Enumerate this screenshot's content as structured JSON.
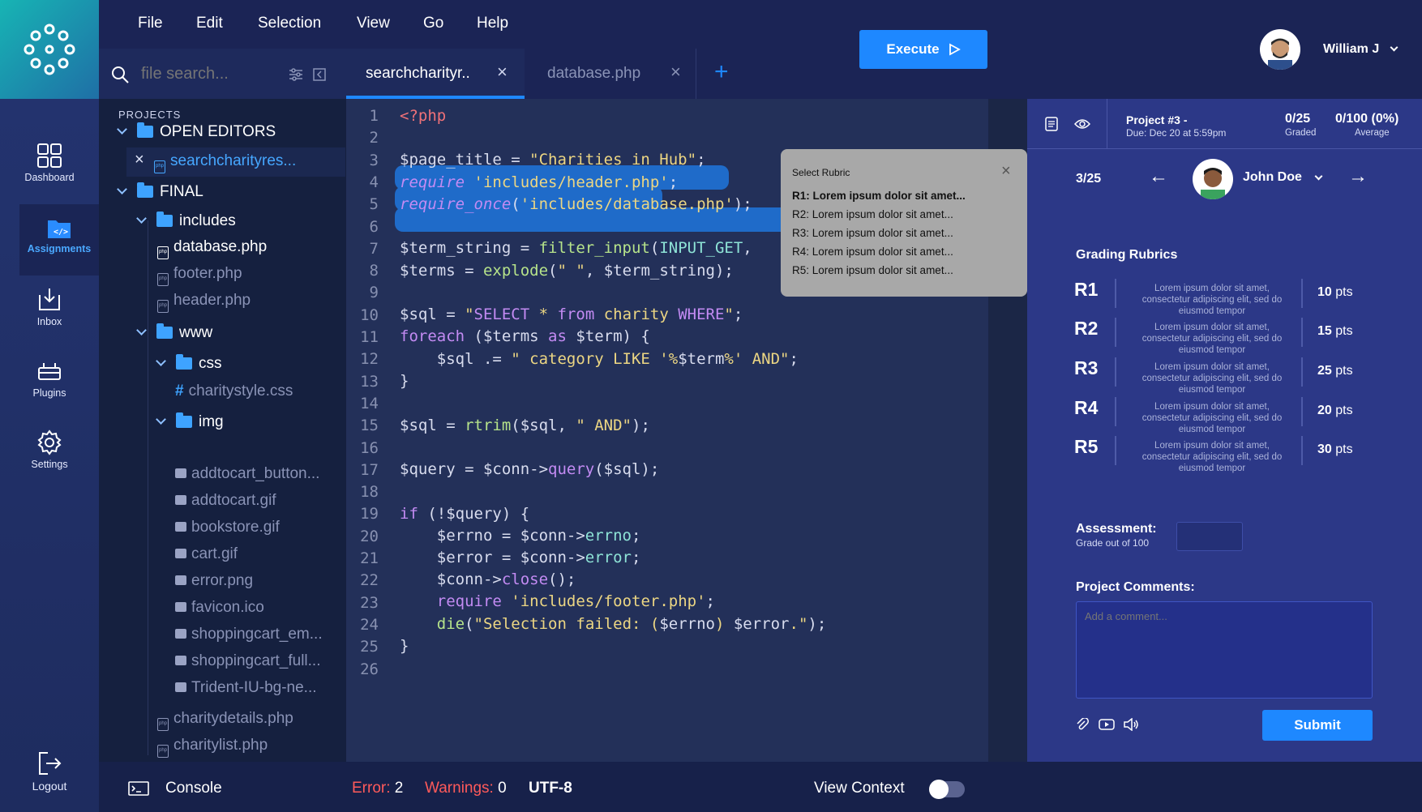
{
  "menu": [
    "File",
    "Edit",
    "Selection",
    "View",
    "Go",
    "Help"
  ],
  "execute_label": "Execute",
  "user_name": "William J",
  "search_placeholder": "file search...",
  "tabs": [
    {
      "label": "searchcharityr.."
    },
    {
      "label": "database.php"
    }
  ],
  "sidebar": [
    {
      "label": "Dashboard"
    },
    {
      "label": "Assignments"
    },
    {
      "label": "Inbox"
    },
    {
      "label": "Plugins"
    },
    {
      "label": "Settings"
    },
    {
      "label": "Logout"
    }
  ],
  "tree": {
    "section": "PROJECTS",
    "open_editors": "OPEN EDITORS",
    "open_file": "searchcharityres...",
    "final": "FINAL",
    "includes": "includes",
    "inc_files": [
      "database.php",
      "footer.php",
      "header.php"
    ],
    "www": "www",
    "css": "css",
    "css_file": "charitystyle.css",
    "img": "img",
    "img_files": [
      "addtocart_button...",
      "addtocart.gif",
      "bookstore.gif",
      "cart.gif",
      "error.png",
      "favicon.ico",
      "shoppingcart_em...",
      "shoppingcart_full...",
      "Trident-IU-bg-ne..."
    ],
    "php_files": [
      "charitydetails.php",
      "charitylist.php"
    ]
  },
  "code_lines": [
    "1",
    "2",
    "3",
    "4",
    "5",
    "6",
    "7",
    "8",
    "9",
    "10",
    "11",
    "12",
    "13",
    "14",
    "15",
    "16",
    "17",
    "18",
    "19",
    "20",
    "21",
    "22",
    "23",
    "24",
    "25",
    "26"
  ],
  "rubric_popup": {
    "title": "Select Rubric",
    "items": [
      "R1: Lorem ipsum dolor sit amet...",
      "R2: Lorem ipsum dolor sit amet...",
      "R3: Lorem ipsum dolor sit amet...",
      "R4: Lorem ipsum dolor sit amet...",
      "R5: Lorem ipsum dolor sit amet..."
    ]
  },
  "project": {
    "title": "Project #3 -",
    "due": "Due: Dec 20 at 5:59pm",
    "graded_value": "0/25",
    "graded_label": "Graded",
    "average_value": "0/100 (0%)",
    "average_label": "Average"
  },
  "student": {
    "position": "3/25",
    "name": "John Doe"
  },
  "rubrics_title": "Grading Rubrics",
  "rubrics": [
    {
      "code": "R1",
      "desc": "Lorem ipsum dolor sit amet, consectetur adipiscing elit, sed do eiusmod tempor",
      "pts": "10",
      "unit": "pts"
    },
    {
      "code": "R2",
      "desc": "Lorem ipsum dolor sit amet, consectetur adipiscing elit, sed do eiusmod tempor",
      "pts": "15",
      "unit": "pts"
    },
    {
      "code": "R3",
      "desc": "Lorem ipsum dolor sit amet, consectetur adipiscing elit, sed do eiusmod tempor",
      "pts": "25",
      "unit": "pts"
    },
    {
      "code": "R4",
      "desc": "Lorem ipsum dolor sit amet, consectetur adipiscing elit, sed do eiusmod tempor",
      "pts": "20",
      "unit": "pts"
    },
    {
      "code": "R5",
      "desc": "Lorem ipsum dolor sit amet, consectetur adipiscing elit, sed do eiusmod tempor",
      "pts": "30",
      "unit": "pts"
    }
  ],
  "assessment": {
    "label": "Assessment:",
    "sub": "Grade out of 100",
    "value": ""
  },
  "comments": {
    "label": "Project Comments:",
    "placeholder": "Add a comment..."
  },
  "submit_label": "Submit",
  "status": {
    "console": "Console",
    "error_label": "Error:",
    "error_count": "2",
    "warn_label": "Warnings:",
    "warn_count": "0",
    "encoding": "UTF-8",
    "view_context": "View Context",
    "view_context_on": false
  },
  "colors": {
    "accent": "#1e88ff",
    "error": "#ff5a5a",
    "selection": "#1f6bc9"
  }
}
